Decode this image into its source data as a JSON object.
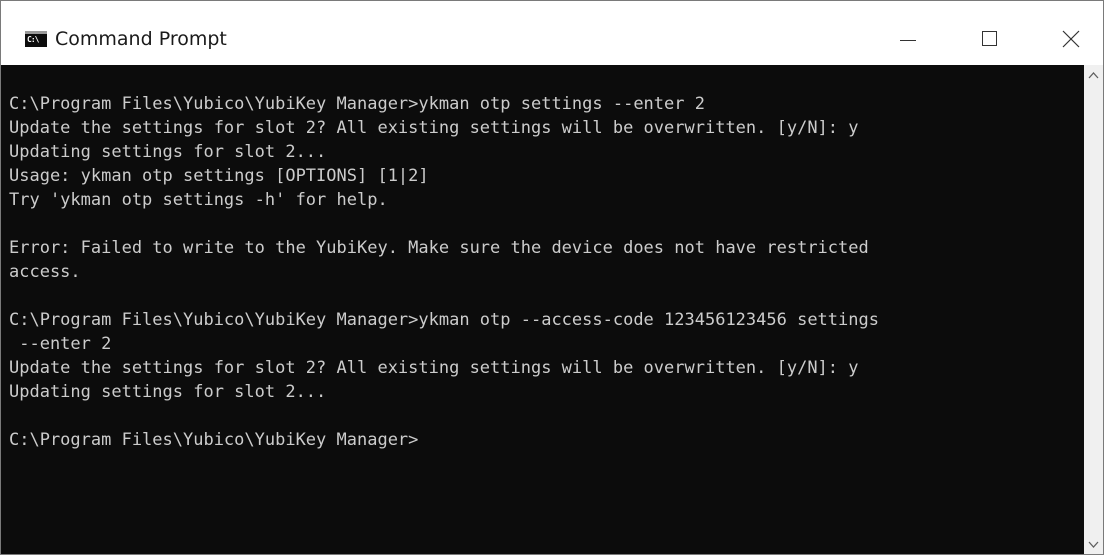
{
  "window": {
    "title": "Command Prompt",
    "icon": "cmd-icon"
  },
  "caption_buttons": {
    "minimize": "minimize-icon",
    "maximize": "maximize-icon",
    "close": "close-icon"
  },
  "console": {
    "lines": [
      "C:\\Program Files\\Yubico\\YubiKey Manager>ykman otp settings --enter 2",
      "Update the settings for slot 2? All existing settings will be overwritten. [y/N]: y",
      "Updating settings for slot 2...",
      "Usage: ykman otp settings [OPTIONS] [1|2]",
      "Try 'ykman otp settings -h' for help.",
      "",
      "Error: Failed to write to the YubiKey. Make sure the device does not have restricted",
      "access.",
      "",
      "C:\\Program Files\\Yubico\\YubiKey Manager>ykman otp --access-code 123456123456 settings",
      " --enter 2",
      "Update the settings for slot 2? All existing settings will be overwritten. [y/N]: y",
      "Updating settings for slot 2...",
      "",
      "C:\\Program Files\\Yubico\\YubiKey Manager>"
    ]
  },
  "colors": {
    "console_background": "#0c0c0c",
    "console_text": "#cccccc",
    "titlebar": "#ffffff"
  }
}
